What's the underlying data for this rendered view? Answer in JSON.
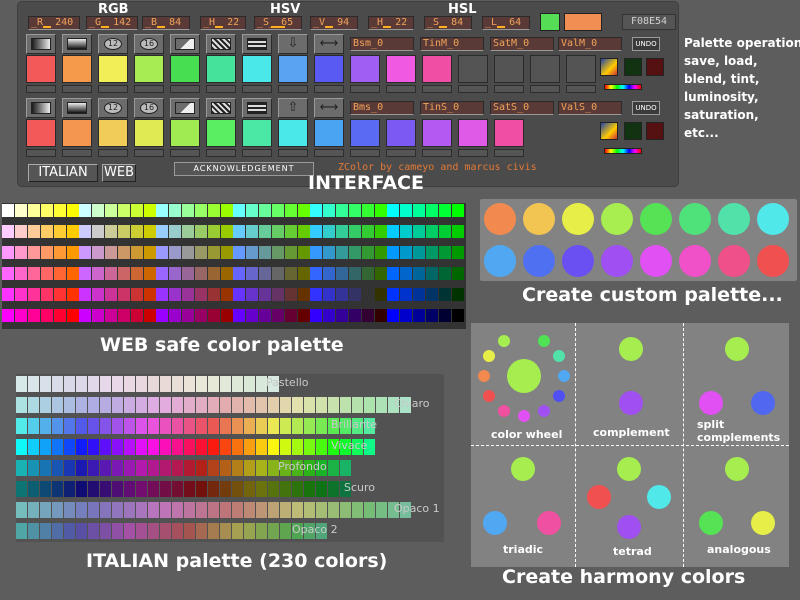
{
  "header": {
    "rgb_label": "RGB",
    "hsv_label": "HSV",
    "hsl_label": "HSL",
    "fields": [
      "_R_ 240",
      "_G_ 142",
      "_B_ 84",
      "_H_ 22",
      "_S_ 65",
      "_V_ 94",
      "_H_ 22",
      "_S_ 84",
      "_L_ 64"
    ],
    "hex": "F08E54",
    "colors": {
      "previous": "#55dd55",
      "current": "#f08e54"
    }
  },
  "rows": [
    {
      "params": [
        "Bsm_0",
        "TinM_0",
        "SatM_0",
        "ValM_0"
      ],
      "undo": "UNDO",
      "swatches": [
        "#f25a5a",
        "#f59a4a",
        "#f2ee58",
        "#a6ec52",
        "#48de52",
        "#44e29a",
        "#4ae8e8",
        "#5aa2f2",
        "#585af2",
        "#a05ef2",
        "#f05ae2",
        "#f04ea4",
        "",
        "",
        "",
        ""
      ]
    },
    {
      "params": [
        "Bms_0",
        "TinS_0",
        "SatS_0",
        "ValS_0"
      ],
      "undo": "UNDO",
      "swatches": [
        "#f25a5a",
        "#f59650",
        "#f2cc58",
        "#e0ea52",
        "#a0ea52",
        "#5aee62",
        "#4ae8a4",
        "#4ae8e8",
        "#4aa4f2",
        "#5a6af2",
        "#7a5af2",
        "#b45af2",
        "#e05ae8",
        "#f04ea4"
      ]
    }
  ],
  "toolbar_icons": {
    "row1": [
      "gradient-icon",
      "gradient-icon",
      "number-12-icon",
      "number-16-icon",
      "triangle-gradient-icon",
      "checker-icon",
      "bars-icon",
      "arrow-down-icon",
      "swap-arrows-icon"
    ],
    "row2": [
      "gradient-icon",
      "gradient-icon",
      "number-12-icon",
      "number-16-icon",
      "triangle-gradient-icon",
      "checker-icon",
      "bars-icon",
      "arrow-up-icon",
      "swap-arrows-icon"
    ],
    "numbers": [
      "12",
      "16"
    ],
    "glyphs": {
      "arrow_down": "⇩",
      "arrow_up": "⇧",
      "swap": "⟷"
    }
  },
  "buttons": {
    "italian": "ITALIAN",
    "web": "WEB",
    "acknowledgement": "ACKNOWLEDGEMENT"
  },
  "credit": "ZColor by cameyo and marcus civis",
  "interface_caption": "INTERFACE",
  "operations": [
    "Palette operation:",
    "save, load,",
    "blend, tint,",
    "luminosity,",
    "saturation,",
    "etc..."
  ],
  "web_caption": "WEB safe color palette",
  "custom_caption": "Create custom palette...",
  "custom_colors": [
    "#f28a50",
    "#f2c552",
    "#e8ee48",
    "#a8ee50",
    "#55e255",
    "#50e27a",
    "#50e2a8",
    "#50e8e8",
    "#50a8f2",
    "#5070f2",
    "#6a50f2",
    "#a050f2",
    "#e050f2",
    "#f050c8",
    "#f0508a",
    "#f05050"
  ],
  "italian_caption": "ITALIAN palette (230 colors)",
  "italian_rows": [
    "Pastello",
    "Chiaro",
    "Brillante",
    "Vivace",
    "Profondo",
    "Scuro",
    "Opaco 1",
    "Opaco 2"
  ],
  "harmony_caption": "Create harmony colors",
  "harmony_labels": [
    "color wheel",
    "complement",
    "split complements",
    "triadic",
    "tetrad",
    "analogous"
  ]
}
